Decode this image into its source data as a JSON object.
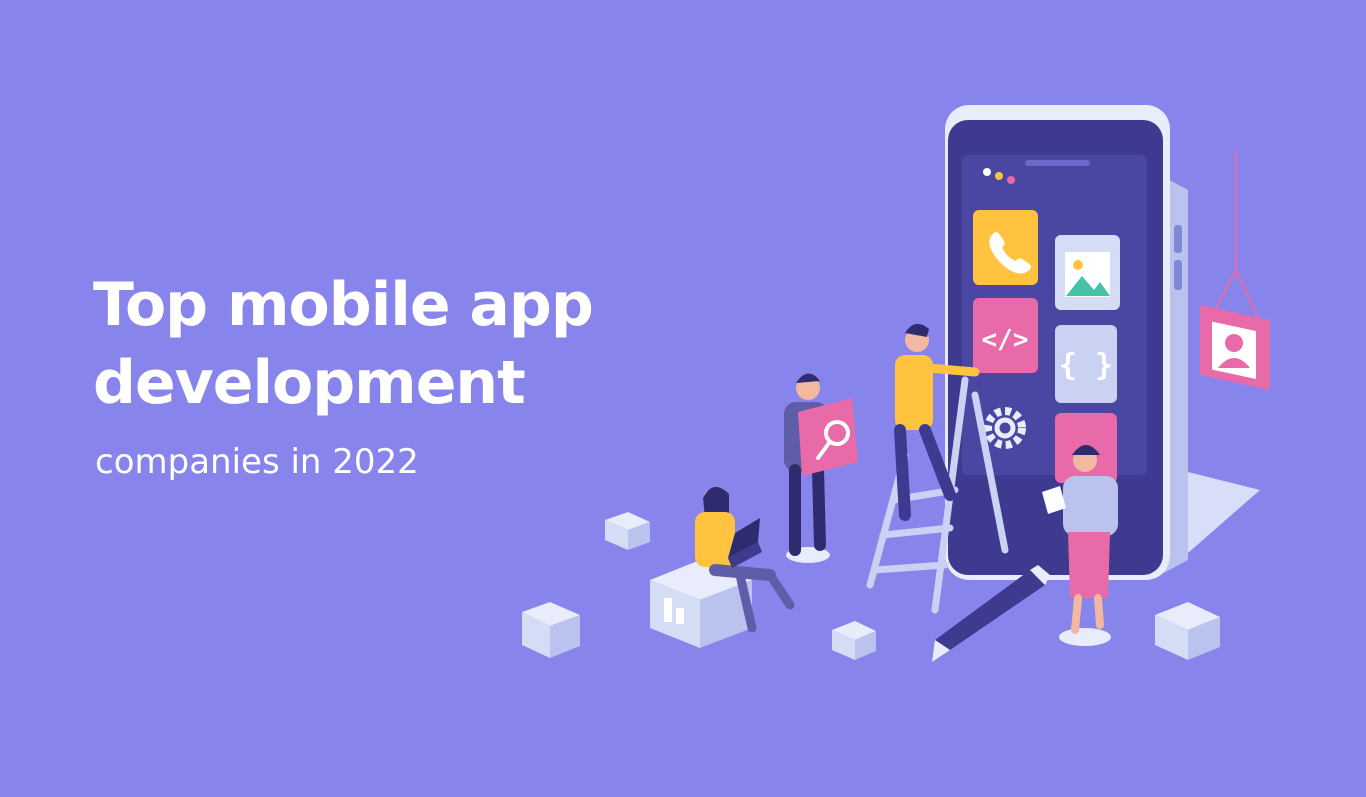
{
  "banner": {
    "headline_line1": "Top mobile app",
    "headline_line2": "development",
    "subline": "companies in 2022"
  },
  "colors": {
    "background": "#8784EB",
    "phone_screen": "#3D3A8F",
    "accent_yellow": "#FFC33F",
    "accent_pink": "#E86AA8",
    "light_tile": "#C9D2F2"
  },
  "illustration": {
    "icons": [
      "phone-icon",
      "image-icon",
      "code-icon",
      "braces-icon",
      "gear-icon",
      "user-icon",
      "search-icon",
      "pencil-icon",
      "laptop-icon"
    ]
  }
}
